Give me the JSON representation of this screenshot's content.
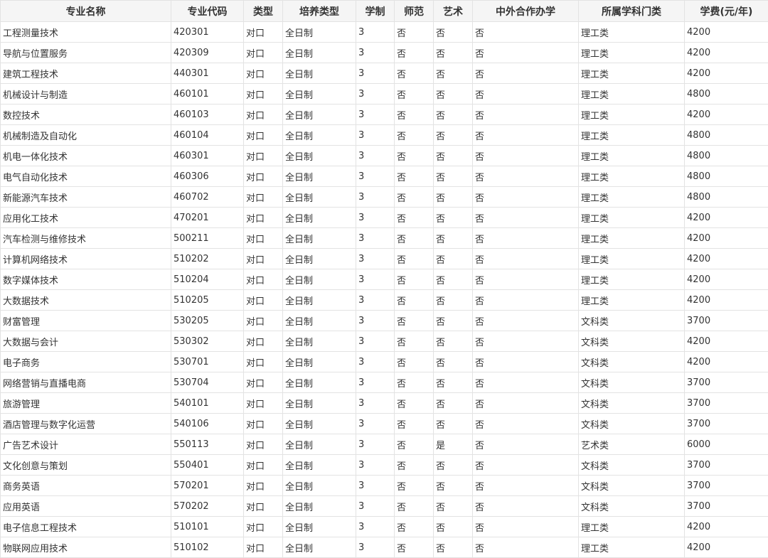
{
  "table": {
    "headers": [
      "专业名称",
      "专业代码",
      "类型",
      "培养类型",
      "学制",
      "师范",
      "艺术",
      "中外合作办学",
      "所属学科门类",
      "学费(元/年)"
    ],
    "rows": [
      [
        "工程测量技术",
        "420301",
        "对口",
        "全日制",
        "3",
        "否",
        "否",
        "否",
        "理工类",
        "4200"
      ],
      [
        "导航与位置服务",
        "420309",
        "对口",
        "全日制",
        "3",
        "否",
        "否",
        "否",
        "理工类",
        "4200"
      ],
      [
        "建筑工程技术",
        "440301",
        "对口",
        "全日制",
        "3",
        "否",
        "否",
        "否",
        "理工类",
        "4200"
      ],
      [
        "机械设计与制造",
        "460101",
        "对口",
        "全日制",
        "3",
        "否",
        "否",
        "否",
        "理工类",
        "4800"
      ],
      [
        "数控技术",
        "460103",
        "对口",
        "全日制",
        "3",
        "否",
        "否",
        "否",
        "理工类",
        "4200"
      ],
      [
        "机械制造及自动化",
        "460104",
        "对口",
        "全日制",
        "3",
        "否",
        "否",
        "否",
        "理工类",
        "4800"
      ],
      [
        "机电一体化技术",
        "460301",
        "对口",
        "全日制",
        "3",
        "否",
        "否",
        "否",
        "理工类",
        "4800"
      ],
      [
        "电气自动化技术",
        "460306",
        "对口",
        "全日制",
        "3",
        "否",
        "否",
        "否",
        "理工类",
        "4800"
      ],
      [
        "新能源汽车技术",
        "460702",
        "对口",
        "全日制",
        "3",
        "否",
        "否",
        "否",
        "理工类",
        "4800"
      ],
      [
        "应用化工技术",
        "470201",
        "对口",
        "全日制",
        "3",
        "否",
        "否",
        "否",
        "理工类",
        "4200"
      ],
      [
        "汽车检测与维修技术",
        "500211",
        "对口",
        "全日制",
        "3",
        "否",
        "否",
        "否",
        "理工类",
        "4200"
      ],
      [
        "计算机网络技术",
        "510202",
        "对口",
        "全日制",
        "3",
        "否",
        "否",
        "否",
        "理工类",
        "4200"
      ],
      [
        "数字媒体技术",
        "510204",
        "对口",
        "全日制",
        "3",
        "否",
        "否",
        "否",
        "理工类",
        "4200"
      ],
      [
        "大数据技术",
        "510205",
        "对口",
        "全日制",
        "3",
        "否",
        "否",
        "否",
        "理工类",
        "4200"
      ],
      [
        "财富管理",
        "530205",
        "对口",
        "全日制",
        "3",
        "否",
        "否",
        "否",
        "文科类",
        "3700"
      ],
      [
        "大数据与会计",
        "530302",
        "对口",
        "全日制",
        "3",
        "否",
        "否",
        "否",
        "文科类",
        "4200"
      ],
      [
        "电子商务",
        "530701",
        "对口",
        "全日制",
        "3",
        "否",
        "否",
        "否",
        "文科类",
        "4200"
      ],
      [
        "网络营销与直播电商",
        "530704",
        "对口",
        "全日制",
        "3",
        "否",
        "否",
        "否",
        "文科类",
        "3700"
      ],
      [
        "旅游管理",
        "540101",
        "对口",
        "全日制",
        "3",
        "否",
        "否",
        "否",
        "文科类",
        "3700"
      ],
      [
        "酒店管理与数字化运营",
        "540106",
        "对口",
        "全日制",
        "3",
        "否",
        "否",
        "否",
        "文科类",
        "3700"
      ],
      [
        "广告艺术设计",
        "550113",
        "对口",
        "全日制",
        "3",
        "否",
        "是",
        "否",
        "艺术类",
        "6000"
      ],
      [
        "文化创意与策划",
        "550401",
        "对口",
        "全日制",
        "3",
        "否",
        "否",
        "否",
        "文科类",
        "3700"
      ],
      [
        "商务英语",
        "570201",
        "对口",
        "全日制",
        "3",
        "否",
        "否",
        "否",
        "文科类",
        "3700"
      ],
      [
        "应用英语",
        "570202",
        "对口",
        "全日制",
        "3",
        "否",
        "否",
        "否",
        "文科类",
        "3700"
      ],
      [
        "电子信息工程技术",
        "510101",
        "对口",
        "全日制",
        "3",
        "否",
        "否",
        "否",
        "理工类",
        "4200"
      ],
      [
        "物联网应用技术",
        "510102",
        "对口",
        "全日制",
        "3",
        "否",
        "否",
        "否",
        "理工类",
        "4200"
      ]
    ]
  }
}
